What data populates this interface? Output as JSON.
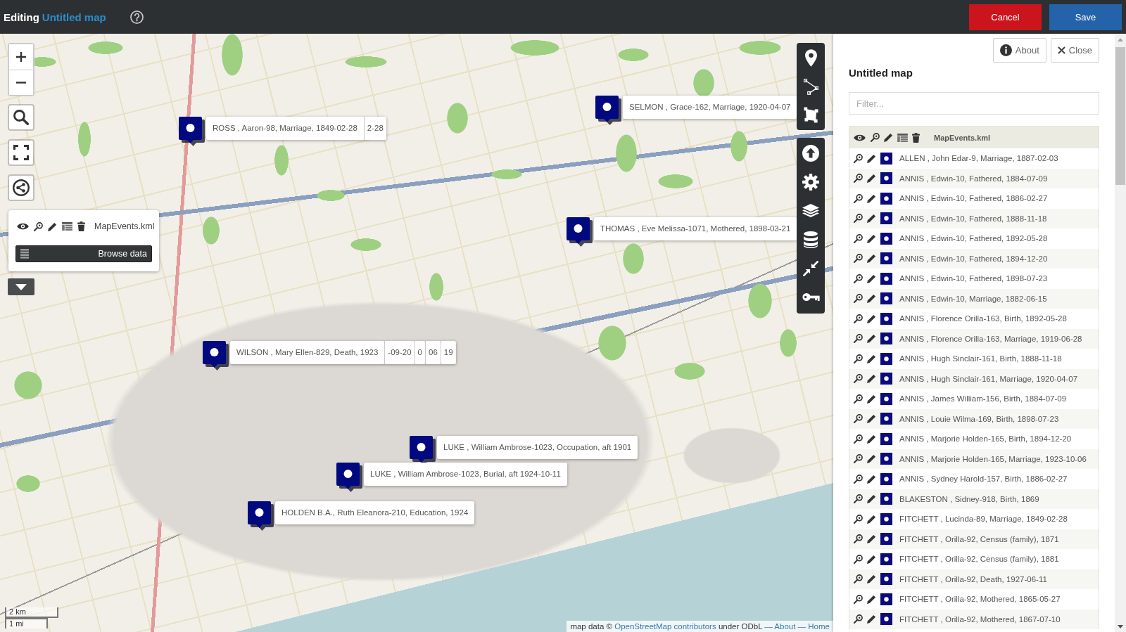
{
  "header": {
    "mode_label": "Editing",
    "map_title": "Untitled map",
    "actions": [
      {
        "label": "Cancel",
        "kind": "cancel"
      },
      {
        "label": "Save",
        "kind": "save"
      }
    ]
  },
  "map": {
    "layer_switcher": {
      "layer_name": "MapEvents.kml",
      "browse_label": "Browse data"
    },
    "markers": [
      {
        "label": "SELMON , Grace-162, Marriage, 1920-04-07"
      },
      {
        "label": "ROSS , Aaron-98, Marriage, 1849-02-28",
        "stacked_label_ends": [
          "2-28"
        ]
      },
      {
        "label": "THOMAS , Eve Melissa-1071, Mothered, 1898-03-21"
      },
      {
        "label": "WILSON , Mary Ellen-829, Death, 1923",
        "stacked_label_ends": [
          "-09-20",
          "0",
          "06",
          "19"
        ]
      },
      {
        "label": "LUKE , William Ambrose-1023, Occupation, aft 1901"
      },
      {
        "label": "LUKE , William Ambrose-1023, Burial, aft 1924-10-11"
      },
      {
        "label": "HOLDEN B.A., Ruth Eleanora-210, Education, 1924"
      }
    ],
    "scale": {
      "metric": "2 km",
      "imperial": "1 mi"
    },
    "attribution": [
      {
        "kind": "text",
        "text": "map data ©"
      },
      {
        "kind": "link",
        "text": "OpenStreetMap contributors"
      },
      {
        "kind": "text",
        "text": "under ODbL"
      },
      {
        "kind": "link",
        "text": "— About — Home"
      }
    ]
  },
  "panel": {
    "about_label": "About",
    "close_label": "Close",
    "title": "Untitled map",
    "filter": {
      "placeholder": "Filter..."
    },
    "layer": {
      "name": "MapEvents.kml",
      "features": [
        "ALLEN , John Edar-9, Marriage, 1887-02-03",
        "ANNIS , Edwin-10, Fathered, 1884-07-09",
        "ANNIS , Edwin-10, Fathered, 1886-02-27",
        "ANNIS , Edwin-10, Fathered, 1888-11-18",
        "ANNIS , Edwin-10, Fathered, 1892-05-28",
        "ANNIS , Edwin-10, Fathered, 1894-12-20",
        "ANNIS , Edwin-10, Fathered, 1898-07-23",
        "ANNIS , Edwin-10, Marriage, 1882-06-15",
        "ANNIS , Florence Orilla-163, Birth, 1892-05-28",
        "ANNIS , Florence Orilla-163, Marriage, 1919-06-28",
        "ANNIS , Hugh Sinclair-161, Birth, 1888-11-18",
        "ANNIS , Hugh Sinclair-161, Marriage, 1920-04-07",
        "ANNIS , James William-156, Birth, 1884-07-09",
        "ANNIS , Louie Wilma-169, Birth, 1898-07-23",
        "ANNIS , Marjorie Holden-165, Birth, 1894-12-20",
        "ANNIS , Marjorie Holden-165, Marriage, 1923-10-06",
        "ANNIS , Sydney Harold-157, Birth, 1886-02-27",
        "BLAKESTON , Sidney-918, Birth, 1869",
        "FITCHETT , Lucinda-89, Marriage, 1849-02-28",
        "FITCHETT , Orilla-92, Census (family), 1871",
        "FITCHETT , Orilla-92, Census (family), 1881",
        "FITCHETT , Orilla-92, Death, 1927-06-11",
        "FITCHETT , Orilla-92, Mothered, 1865-05-27",
        "FITCHETT , Orilla-92, Mothered, 1867-07-10"
      ]
    }
  }
}
